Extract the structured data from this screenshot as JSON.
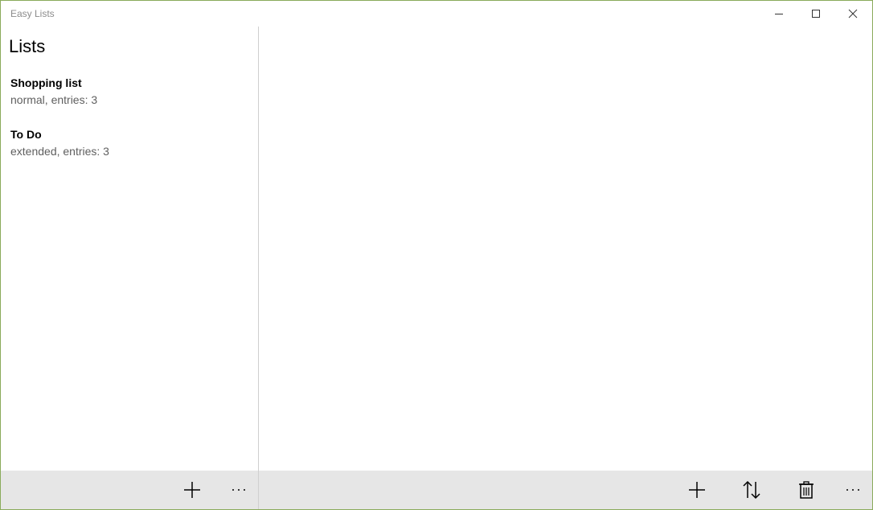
{
  "window": {
    "title": "Easy Lists"
  },
  "caption_buttons": {
    "minimize_icon": "minimize-icon",
    "maximize_icon": "maximize-icon",
    "close_icon": "close-icon"
  },
  "left_pane": {
    "title": "Lists",
    "items": [
      {
        "name": "Shopping list",
        "detail": "normal, entries: 3"
      },
      {
        "name": "To Do",
        "detail": "extended, entries: 3"
      }
    ],
    "commands": [
      {
        "icon": "add-icon"
      },
      {
        "icon": "more-icon",
        "label": "···"
      }
    ]
  },
  "right_pane": {
    "commands": [
      {
        "icon": "add-icon"
      },
      {
        "icon": "sort-icon"
      },
      {
        "icon": "delete-icon"
      },
      {
        "icon": "more-icon",
        "label": "···"
      }
    ]
  },
  "colors": {
    "window_border": "#8aab5b",
    "command_bar": "#e6e6e6",
    "divider": "#cfcfcf"
  }
}
